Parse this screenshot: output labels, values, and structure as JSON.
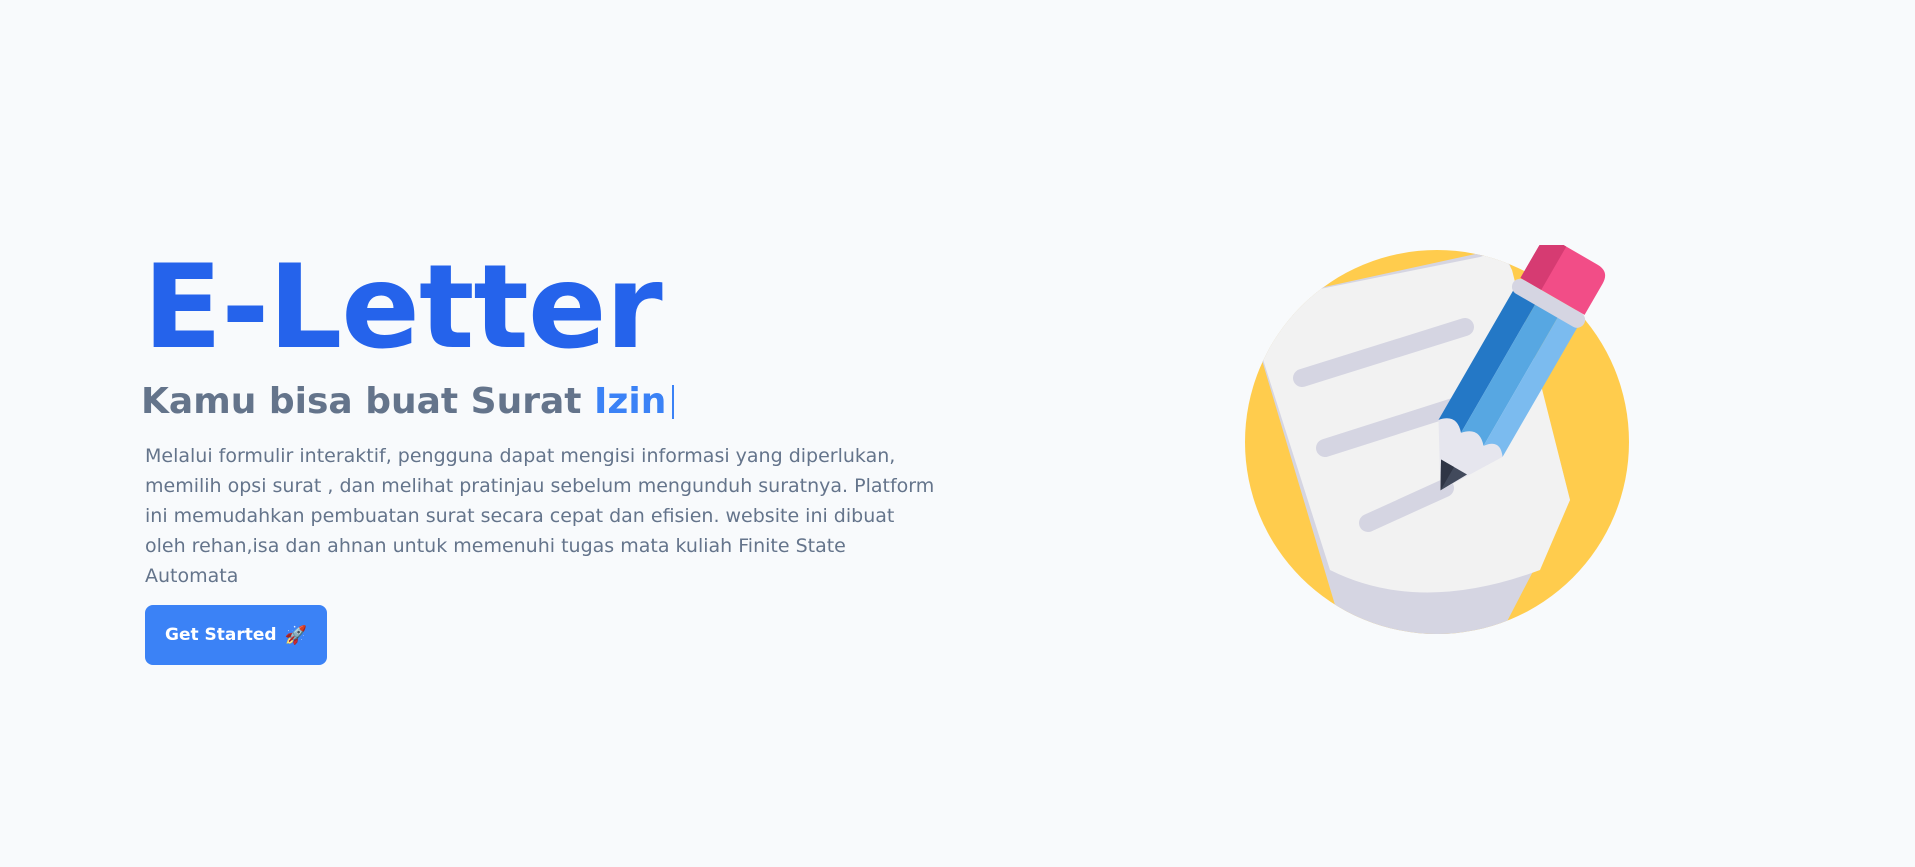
{
  "hero": {
    "title": "E-Letter",
    "tagline_prefix": "Kamu bisa buat Surat",
    "tagline_typed": "Izin",
    "description": "Melalui formulir interaktif, pengguna dapat mengisi informasi yang diperlukan, memilih opsi surat , dan melihat pratinjau sebelum mengunduh suratnya. Platform ini memudahkan pembuatan surat secara cepat dan efisien. website ini dibuat oleh rehan,isa dan ahnan untuk memenuhi tugas mata kuliah Finite State Automata",
    "cta_label": "Get Started",
    "cta_icon": "🚀",
    "illustration": "paper-and-pencil-icon"
  },
  "colors": {
    "background": "#f8fafc",
    "title": "#2563eb",
    "accent": "#3b82f6",
    "muted_text": "#64748b",
    "circle": "#ffcc4d",
    "paper": "#f2f2f2",
    "paper_shadow": "#d5d5e2",
    "pencil_blue": "#57a7e2",
    "eraser_pink": "#f24d87"
  }
}
